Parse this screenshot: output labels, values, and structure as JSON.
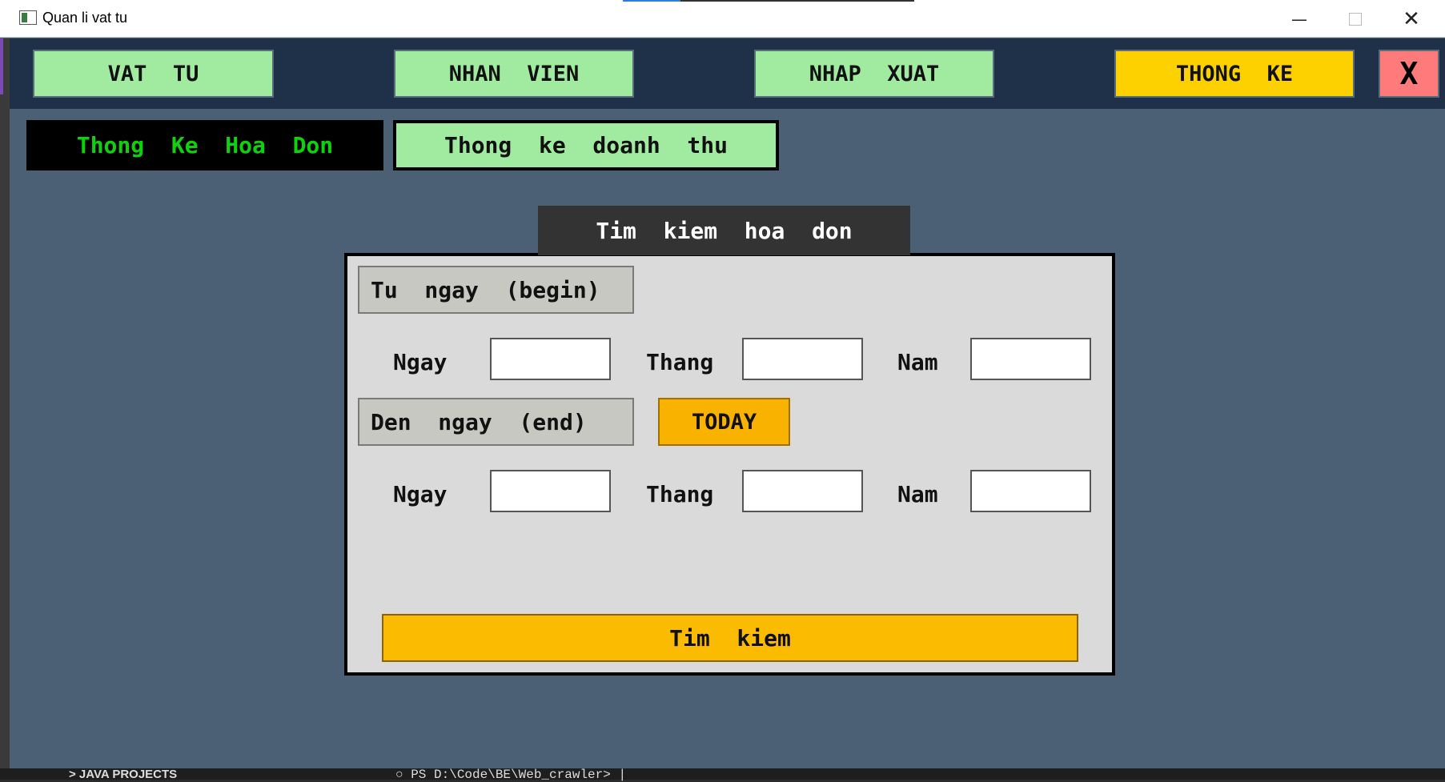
{
  "window": {
    "title": "Quan li vat tu",
    "controls": {
      "minimize": "—",
      "close": "✕"
    }
  },
  "navbar": {
    "vat_tu": "VAT  TU",
    "nhan_vien": "NHAN  VIEN",
    "nhap_xuat": "NHAP  XUAT",
    "thong_ke": "THONG  KE",
    "close": "X"
  },
  "subtabs": {
    "hoa_don": "Thong  Ke  Hoa  Don",
    "doanh_thu": "Thong  ke  doanh  thu"
  },
  "search_panel": {
    "header": "Tim  kiem  hoa  don",
    "begin_label": "Tu  ngay  (begin)",
    "end_label": "Den  ngay  (end)",
    "today_button": "TODAY",
    "search_button": "Tim  kiem",
    "begin": {
      "day_label": "Ngay",
      "month_label": "Thang",
      "year_label": "Nam",
      "day": "",
      "month": "",
      "year": ""
    },
    "end": {
      "day_label": "Ngay",
      "month_label": "Thang",
      "year_label": "Nam",
      "day": "",
      "month": "",
      "year": ""
    }
  },
  "background": {
    "explorer_text": "> JAVA PROJECTS",
    "terminal_text": "○ PS D:\\Code\\BE\\Web_crawler> |"
  },
  "colors": {
    "nav_bg": "#1e3148",
    "content_bg": "#4b6075",
    "nav_button": "#a1eba1",
    "active_nav": "#fdd000",
    "close_button": "#ff7a7a",
    "panel_bg": "#dadada",
    "action_button": "#fbbb00",
    "active_tab_text": "#0fd20f"
  }
}
